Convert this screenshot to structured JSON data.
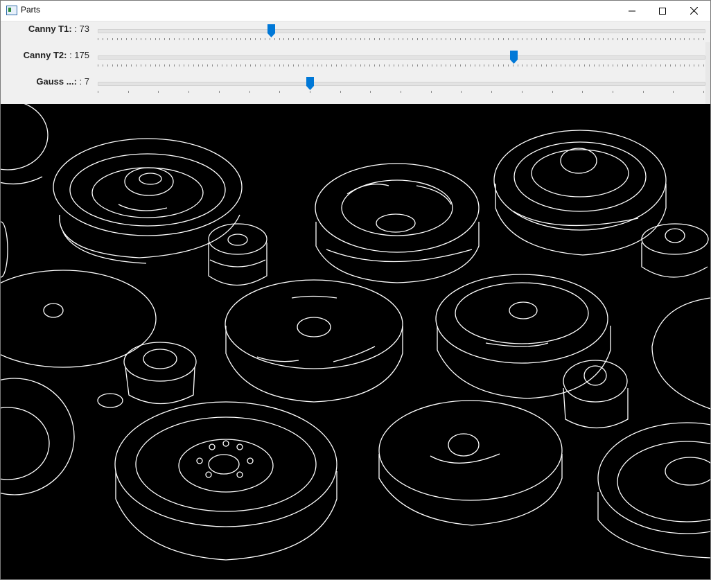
{
  "window": {
    "title": "Parts",
    "icon": "window-app-icon",
    "buttons": {
      "minimize": "minimize-icon",
      "maximize": "maximize-icon",
      "close": "close-icon"
    }
  },
  "trackbars": [
    {
      "name": "Canny T1",
      "label": "Canny T1: ",
      "value_text": ": 73",
      "value": 73,
      "max": 255,
      "ticks": 128
    },
    {
      "name": "Canny T2",
      "label": "Canny T2: ",
      "value_text": ": 175",
      "value": 175,
      "max": 255,
      "ticks": 128
    },
    {
      "name": "Gauss",
      "label": "Gauss ...: ",
      "value_text": ": 7",
      "value": 7,
      "max": 20,
      "ticks": 21
    }
  ],
  "colors": {
    "accent": "#0078d7",
    "edge": "#ffffff",
    "canvas": "#000000"
  },
  "image": {
    "description_icon": "canny-edge-image",
    "content": "edge outlines of pulleys and bearings"
  }
}
